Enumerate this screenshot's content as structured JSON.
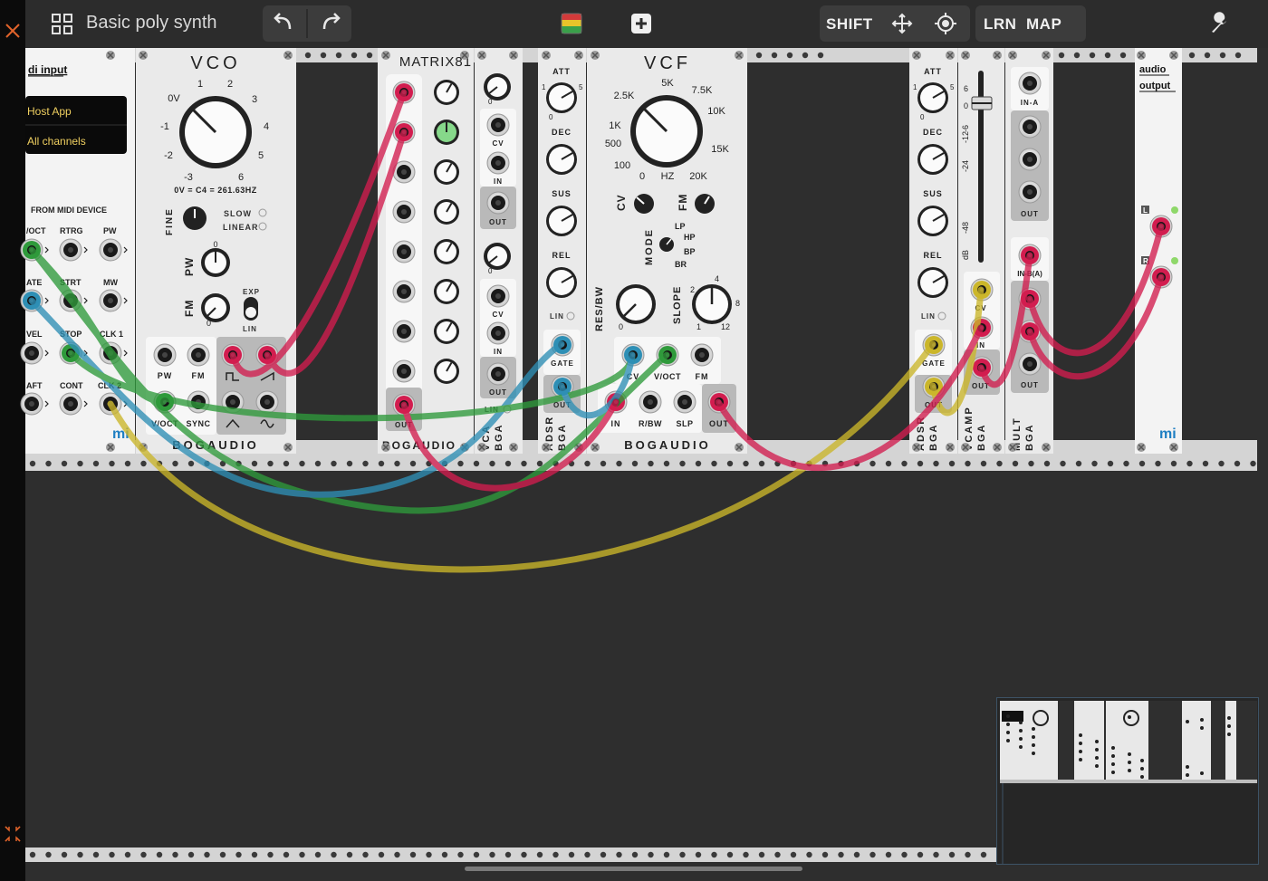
{
  "app": {
    "title": "Basic poly synth",
    "shift_label": "SHIFT",
    "learn_label": "LRN",
    "map_label": "MAP"
  },
  "icons": {
    "close": "close-icon",
    "grid": "grid-icon",
    "undo": "undo-icon",
    "redo": "redo-icon",
    "color": "color-swatch-icon",
    "add": "add-module-icon",
    "move": "move-icon",
    "target": "target-icon",
    "settings": "wrench-icon",
    "collapse": "collapse-icon"
  },
  "colors": {
    "accent_close": "#e0632a",
    "cable_red": "#d21d4f",
    "cable_green": "#2f9a3b",
    "cable_blue": "#2e8fb5",
    "cable_yellow": "#cbb62a",
    "brand_blue": "#1e7fc2"
  },
  "modules": {
    "midi": {
      "title": "di input",
      "host": "Host App",
      "channels": "All channels",
      "from": "FROM MIDI DEVICE",
      "jacks": [
        "/OCT",
        "RTRG",
        "PW",
        "ATE",
        "STRT",
        "MW",
        "VEL",
        "STOP",
        "CLK 1",
        "AFT",
        "CONT",
        "CLK 2"
      ],
      "logo": "mi"
    },
    "vco": {
      "title": "VCO",
      "freq_ticks": [
        "0V",
        "1",
        "2",
        "3",
        "4",
        "5",
        "6",
        "-1",
        "-2",
        "-3"
      ],
      "readout": "0V = C4 = 261.63HZ",
      "fine": "FINE",
      "slow": "SLOW",
      "linear": "LINEAR",
      "pw": "PW",
      "fm": "FM",
      "exp": "EXP",
      "lin": "LIN",
      "jack_pw": "PW",
      "jack_fm": "FM",
      "voct": "V/OCT",
      "sync": "SYNC",
      "brand": "BOGAUDIO",
      "pw_tick": "0",
      "fm_tick": "0"
    },
    "matrix": {
      "title": "MATRIX81",
      "out": "OUT",
      "brand": "BOGAUDIO"
    },
    "vca1": {
      "cv": "CV",
      "in": "IN",
      "out": "OUT",
      "cv2": "CV",
      "in2": "IN",
      "out2": "OUT",
      "lin": "LIN",
      "name": "VCA",
      "brand": "BGA",
      "tick": "0",
      "tick2": "0"
    },
    "adsr1": {
      "att": "ATT",
      "dec": "DEC",
      "sus": "SUS",
      "rel": "REL",
      "lin": "LIN",
      "gate": "GATE",
      "out": "OUT",
      "name": "ADSR",
      "brand": "BGA",
      "t1": "1",
      "t5": "5",
      "t0": "0"
    },
    "vcf": {
      "title": "VCF",
      "freq_ticks": [
        "2.5K",
        "5K",
        "7.5K",
        "10K",
        "1K",
        "15K",
        "500",
        "100",
        "0",
        "HZ",
        "20K"
      ],
      "cv": "CV",
      "fm": "FM",
      "mode": "MODE",
      "modes": [
        "LP",
        "HP",
        "BP",
        "BR"
      ],
      "resbw": "RES/BW",
      "slope": "SLOPE",
      "slope_ticks": [
        "2",
        "4",
        "8",
        "1",
        "12"
      ],
      "res_tick": "0",
      "jack_cv": "CV",
      "jack_voct": "V/OCT",
      "jack_fm": "FM",
      "in": "IN",
      "rbw": "R/BW",
      "slp": "SLP",
      "out": "OUT",
      "brand": "BOGAUDIO"
    },
    "adsr2": {
      "att": "ATT",
      "dec": "DEC",
      "sus": "SUS",
      "rel": "REL",
      "lin": "LIN",
      "gate": "GATE",
      "out": "OUT",
      "name": "ADSR",
      "brand": "BGA",
      "t1": "1",
      "t5": "5",
      "t0": "0"
    },
    "vcamp": {
      "scale": [
        "6",
        "0",
        "-6",
        "-12",
        "-24",
        "-48",
        "dB"
      ],
      "cv": "CV",
      "in": "IN",
      "out": "OUT",
      "name": "VCAMP",
      "brand": "BGA",
      "level_fraction": 0.17
    },
    "mult": {
      "ina": "IN-A",
      "out": "OUT",
      "inb": "IN-B(A)",
      "out2": "OUT",
      "name": "MULT",
      "brand": "BGA"
    },
    "audio": {
      "title1": "audio",
      "title2": "output",
      "l": "L",
      "r": "R",
      "logo": "mi"
    }
  }
}
